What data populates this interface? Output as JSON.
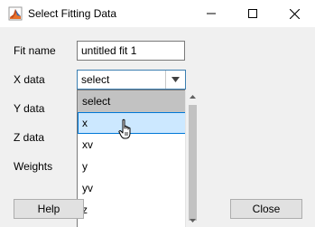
{
  "window": {
    "title": "Select Fitting Data",
    "icon": "matlab-icon"
  },
  "form": {
    "fit_name_label": "Fit name",
    "fit_name_value": "untitled fit 1",
    "x_data_label": "X data",
    "x_data_selected": "select",
    "y_data_label": "Y data",
    "z_data_label": "Z data",
    "weights_label": "Weights"
  },
  "dropdown": {
    "options": [
      "select",
      "x",
      "xv",
      "y",
      "yv",
      "z"
    ],
    "selected_index": 0,
    "hover_index": 1
  },
  "buttons": {
    "help": "Help",
    "close": "Close"
  },
  "colors": {
    "hover_bg": "#cce8ff",
    "hover_border": "#0078d7",
    "selected_bg": "#c2c2c2",
    "focus_border": "#3c7fb1"
  }
}
